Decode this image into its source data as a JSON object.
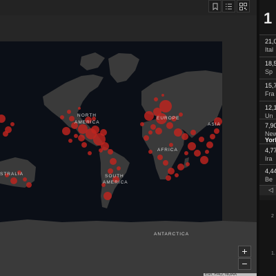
{
  "map": {
    "continent_labels": [
      "NORTH",
      "AMERICA",
      "SOUTH",
      "AMERICA",
      "EUROPE",
      "ASIA",
      "AFRICA",
      "STRALIA",
      "ANTARCTICA"
    ],
    "zoom_in_label": "+",
    "zoom_out_label": "−",
    "attribution": "Esri, FAO, NOAA",
    "bubble_color": "#c0251f",
    "land_color": "#3a3a3a",
    "ocean_color": "#0b0f17"
  },
  "toolbar": {
    "icons": [
      "bookmark-icon",
      "list-icon",
      "qr-code-icon"
    ]
  },
  "sidebar": {
    "total": "1",
    "rows": [
      {
        "count": "21,0",
        "place": "Ital"
      },
      {
        "count": "18,5",
        "place": "Sp"
      },
      {
        "count": "15,7",
        "place": "Fra"
      },
      {
        "count": "12,1",
        "place": "Un"
      },
      {
        "count": "7,90",
        "place": "New",
        "place_bold": "York"
      },
      {
        "count": "4,77",
        "place": "Ira"
      },
      {
        "count": "4,44",
        "place": "Be"
      }
    ],
    "nav_arrow": "◁",
    "chart_ticks": [
      "2",
      "1."
    ]
  }
}
